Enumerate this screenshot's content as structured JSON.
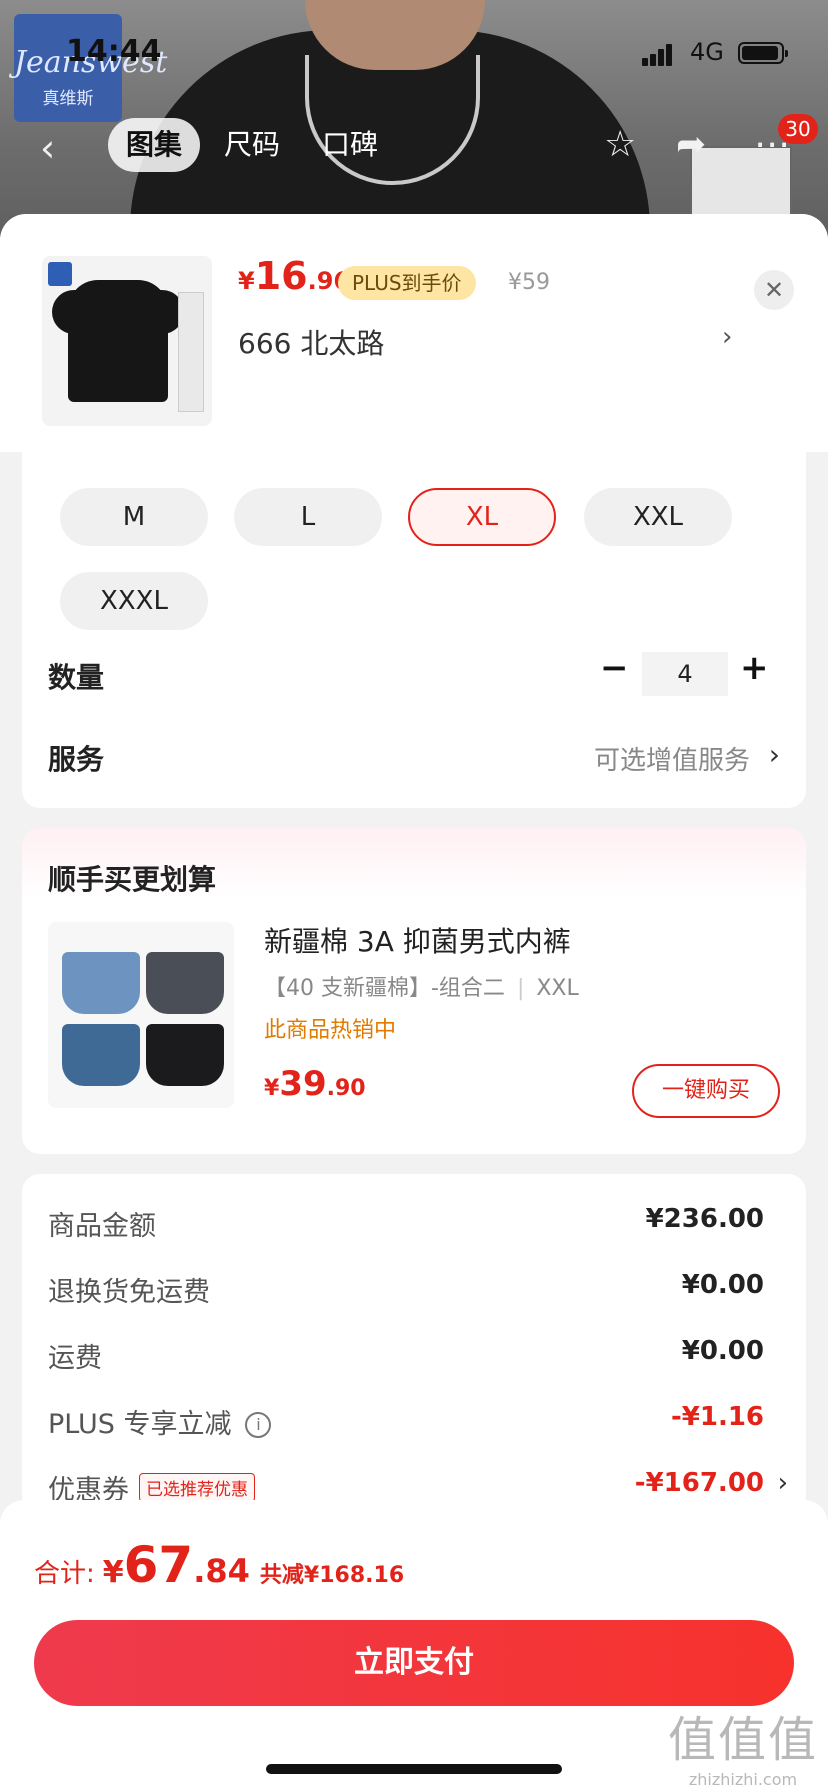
{
  "status": {
    "time": "14:44",
    "network": "4G"
  },
  "brand": {
    "logo_line1": "Jeanswest",
    "logo_line2": "真维斯"
  },
  "nav": {
    "tabs": [
      "图集",
      "尺码",
      "口碑"
    ],
    "cart_count": "30"
  },
  "product": {
    "price_currency": "¥",
    "price_int": "16",
    "price_dec": ".96",
    "plus_tag": "PLUS到手价",
    "original_price": "¥59",
    "address": "666  北太路"
  },
  "sizes": {
    "options": [
      "M",
      "L",
      "XL",
      "XXL",
      "XXXL"
    ],
    "selected": "XL"
  },
  "quantity": {
    "label": "数量",
    "value": "4",
    "minus": "−",
    "plus": "+"
  },
  "service": {
    "label": "服务",
    "value": "可选增值服务"
  },
  "upsell": {
    "title": "顺手买更划算",
    "name": "新疆棉 3A 抑菌男式内裤",
    "spec_variant": "【40 支新疆棉】-组合二",
    "spec_size": "XXL",
    "status": "此商品热销中",
    "price_currency": "¥",
    "price_int": "39",
    "price_dec": ".90",
    "button": "一键购买"
  },
  "summary": {
    "goods_label": "商品金额",
    "goods_value": "¥236.00",
    "return_label": "退换货免运费",
    "return_value": "¥0.00",
    "shipping_label": "运费",
    "shipping_value": "¥0.00",
    "plus_label": "PLUS 专享立减",
    "plus_value": "-¥1.16",
    "coupon_label": "优惠券",
    "coupon_tag": "已选推荐优惠",
    "coupon_value": "-¥167.00"
  },
  "footer": {
    "total_label": "合计:",
    "total_currency": "¥",
    "total_int": "67",
    "total_dec": ".84",
    "total_saved": "共减¥168.16",
    "pay_button": "立即支付"
  },
  "watermark": {
    "line1": "值值值",
    "line2": "zhizhizhi.com"
  },
  "colors": {
    "accent": "#e2231a",
    "plus_gold": "#ffe5a3",
    "hot_orange": "#e07a00"
  }
}
